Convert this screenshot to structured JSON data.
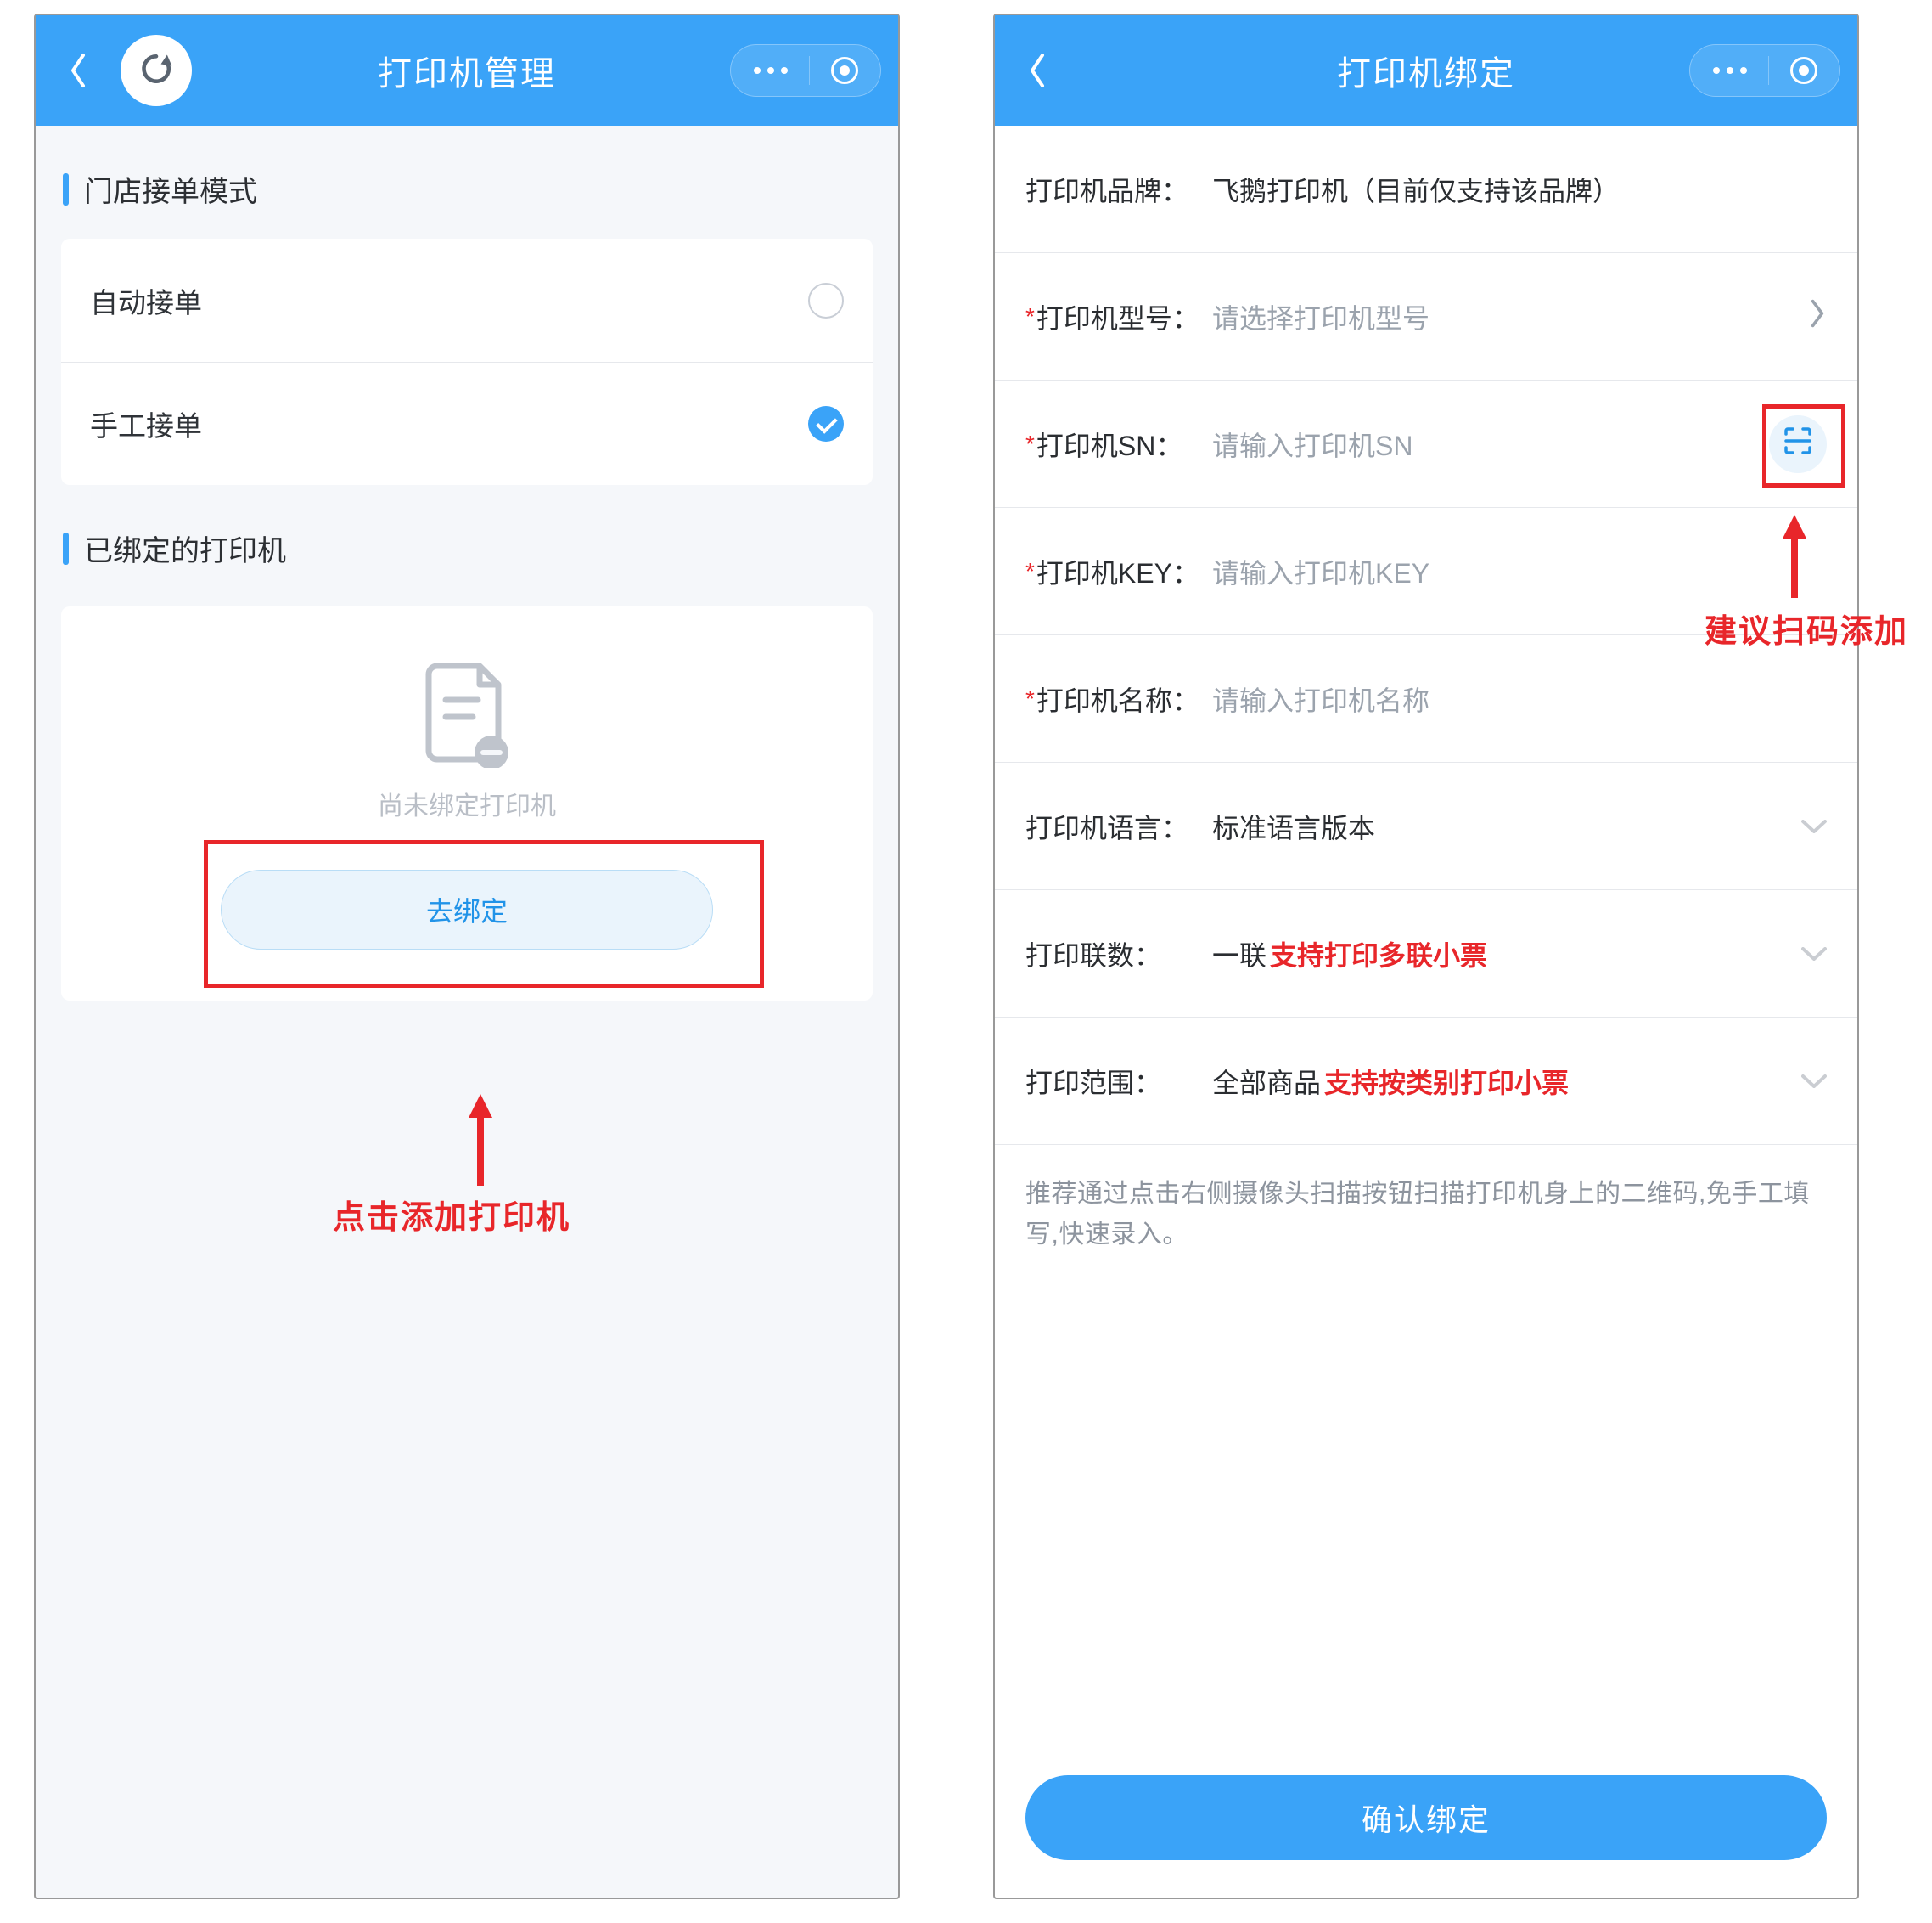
{
  "left": {
    "title": "打印机管理",
    "section_mode": "门店接单模式",
    "mode_auto": "自动接单",
    "mode_manual": "手工接单",
    "section_bound": "已绑定的打印机",
    "empty_text": "尚未绑定打印机",
    "bind_btn": "去绑定",
    "annotation": "点击添加打印机"
  },
  "right": {
    "title": "打印机绑定",
    "rows": {
      "brand_label": "打印机品牌：",
      "brand_value": "飞鹅打印机（目前仅支持该品牌）",
      "model_label": "打印机型号：",
      "model_placeholder": "请选择打印机型号",
      "sn_label": "打印机SN：",
      "sn_placeholder": "请输入打印机SN",
      "key_label": "打印机KEY：",
      "key_placeholder": "请输入打印机KEY",
      "name_label": "打印机名称：",
      "name_placeholder": "请输入打印机名称",
      "lang_label": "打印机语言：",
      "lang_value": "标准语言版本",
      "copies_label": "打印联数：",
      "copies_value": "一联",
      "copies_note": "支持打印多联小票",
      "range_label": "打印范围：",
      "range_value": "全部商品",
      "range_note": "支持按类别打印小票"
    },
    "help": "推荐通过点击右侧摄像头扫描按钮扫描打印机身上的二维码,免手工填写,快速录入。",
    "confirm": "确认绑定",
    "annotation": "建议扫码添加"
  }
}
